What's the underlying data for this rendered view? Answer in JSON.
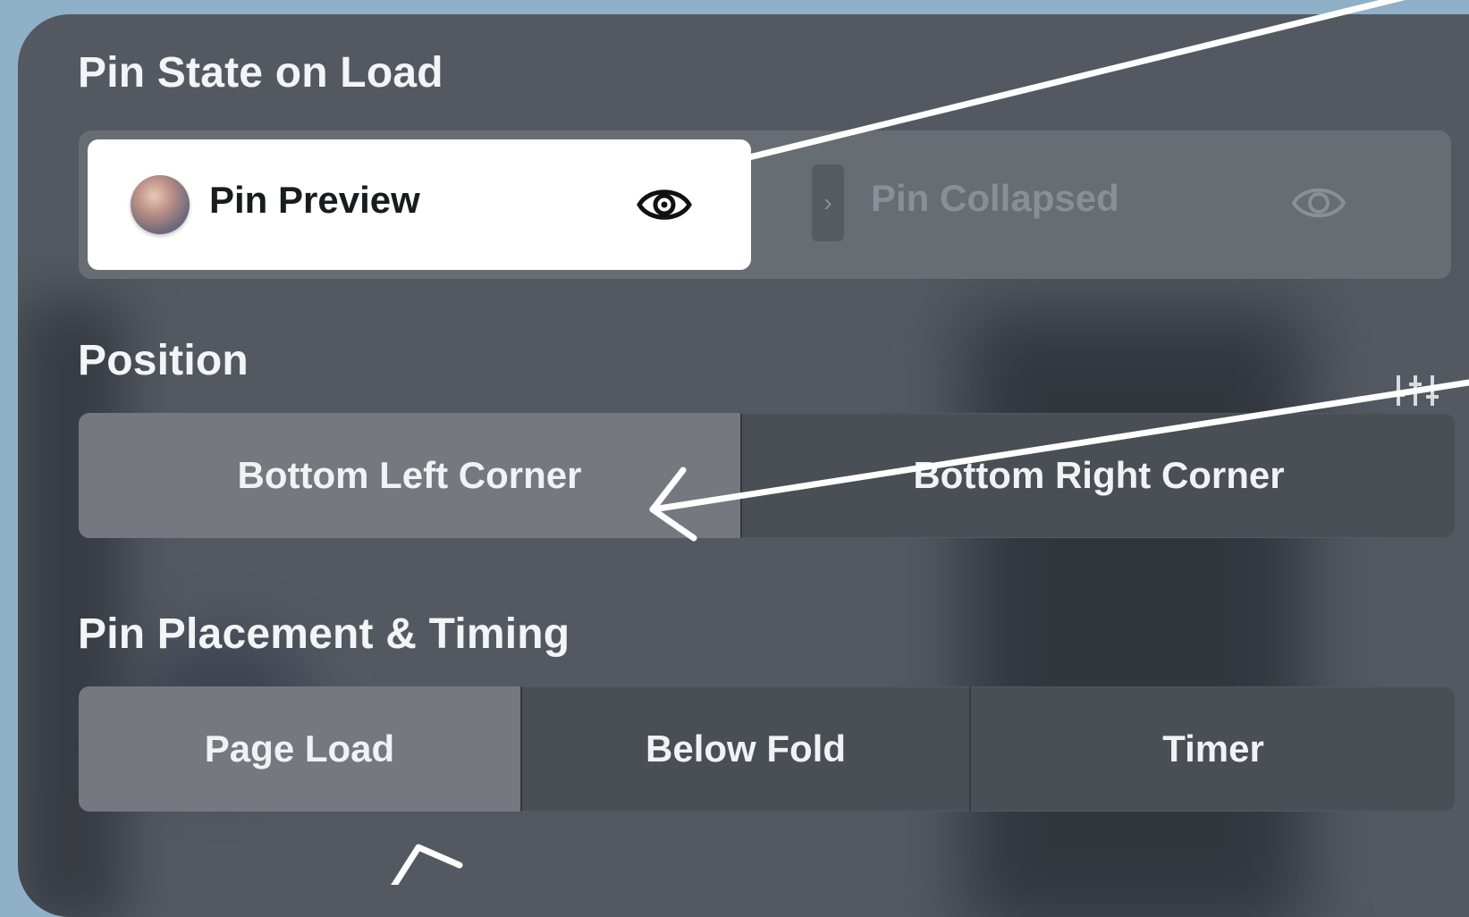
{
  "pin_state": {
    "title": "Pin State on Load",
    "options": [
      {
        "label": "Pin Preview",
        "icon": "eye-icon",
        "selected": true
      },
      {
        "label": "Pin Collapsed",
        "icon": "eye-icon",
        "selected": false
      }
    ]
  },
  "position": {
    "title": "Position",
    "settings_icon": "sliders-icon",
    "options": [
      {
        "label": "Bottom Left Corner",
        "selected": true
      },
      {
        "label": "Bottom Right Corner",
        "selected": false
      }
    ]
  },
  "placement": {
    "title": "Pin Placement & Timing",
    "options": [
      {
        "label": "Page Load",
        "selected": true
      },
      {
        "label": "Below Fold",
        "selected": false
      },
      {
        "label": "Timer",
        "selected": false
      }
    ]
  },
  "colors": {
    "background": "#8fb0c6",
    "panel": "#545961",
    "selected_card": "#ffffff",
    "active_segment": "#75797f",
    "annotation": "#ffffff"
  }
}
